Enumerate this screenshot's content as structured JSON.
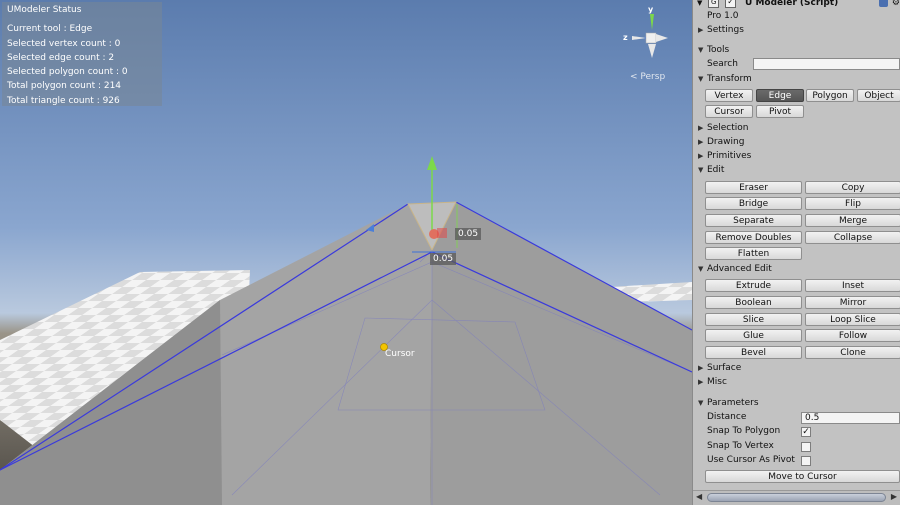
{
  "status": {
    "title": "UModeler Status",
    "lines": [
      "Current tool : Edge",
      "Selected vertex count : 0",
      "Selected edge count : 2",
      "Selected polygon count : 0",
      "Total polygon count : 214",
      "Total triangle count : 926"
    ]
  },
  "viewport": {
    "measure_vertical": "0.05",
    "measure_horizontal": "0.05",
    "cursor_label": "Cursor",
    "gizmo_view": "Persp",
    "gizmo_axes": {
      "y": "y",
      "z": "z"
    }
  },
  "panel": {
    "header_title": "U Modeler (Script)",
    "version": "Pro 1.0",
    "settings": "Settings",
    "tools": "Tools",
    "search_label": "Search",
    "search_value": "",
    "transform": "Transform",
    "transform_buttons": [
      "Vertex",
      "Edge",
      "Polygon",
      "Object"
    ],
    "active_transform": "Edge",
    "transform_buttons_2": [
      "Cursor",
      "Pivot"
    ],
    "selection": "Selection",
    "drawing": "Drawing",
    "primitives": "Primitives",
    "edit": "Edit",
    "edit_buttons": [
      "Eraser",
      "Copy",
      "Bridge",
      "Flip",
      "Separate",
      "Merge",
      "Remove Doubles",
      "Collapse",
      "Flatten"
    ],
    "advanced_edit": "Advanced Edit",
    "advanced_buttons": [
      "Extrude",
      "Inset",
      "Boolean",
      "Mirror",
      "Slice",
      "Loop Slice",
      "Glue",
      "Follow",
      "Bevel",
      "Clone"
    ],
    "surface": "Surface",
    "misc": "Misc",
    "parameters": "Parameters",
    "distance_label": "Distance",
    "distance_value": "0.5",
    "snap_polygon_label": "Snap To Polygon",
    "snap_polygon_checked": true,
    "snap_vertex_label": "Snap To Vertex",
    "snap_vertex_checked": false,
    "use_cursor_pivot_label": "Use Cursor As Pivot",
    "use_cursor_pivot_checked": false,
    "move_to_cursor": "Move to Cursor"
  },
  "colors": {
    "selected_edge": "#3a3adc",
    "accent_active": "#5e5e5e",
    "y_axis": "#7cd84a",
    "x_axis": "#e04848",
    "z_axis": "#3b6fd8"
  }
}
